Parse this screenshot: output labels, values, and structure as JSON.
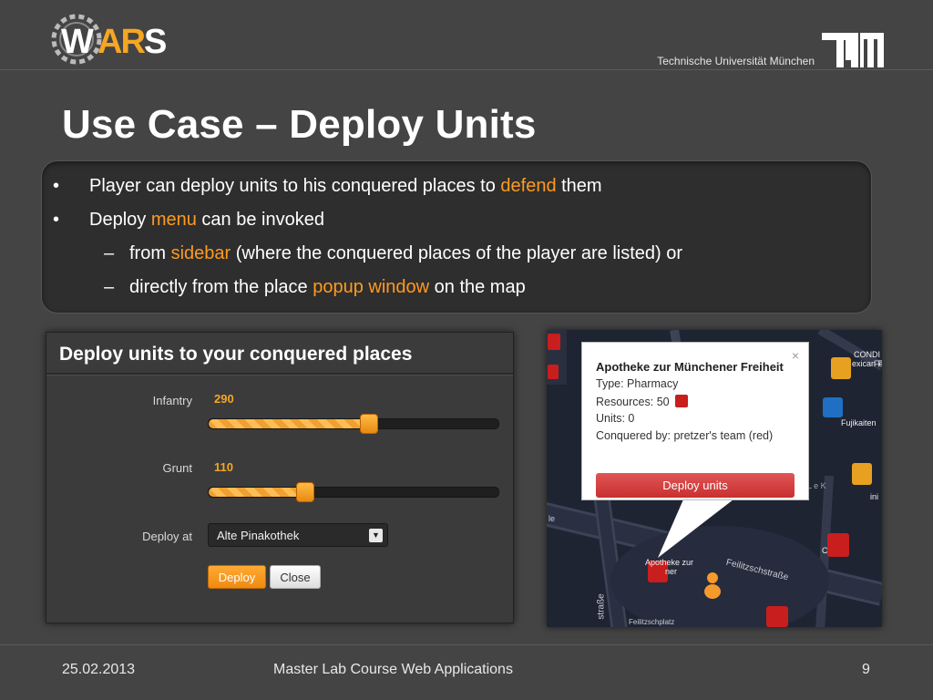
{
  "header": {
    "logo_text": "WARS",
    "university": "Technische Universität München",
    "tum_logo": "TUM"
  },
  "title": "Use Case – Deploy Units",
  "bullets": {
    "b1": {
      "marker": "•",
      "before": "Player can deploy units to his conquered places to ",
      "hl": "defend",
      "after": " them"
    },
    "b2": {
      "marker": "•",
      "before": "Deploy ",
      "hl": "menu",
      "after": " can be invoked"
    },
    "s1": {
      "marker": "–",
      "before": "from ",
      "hl": "sidebar",
      "after": " (where the conquered places of the player are listed) or"
    },
    "s2": {
      "marker": "–",
      "before": "directly from the place ",
      "hl": "popup window",
      "after": " on the map"
    },
    "highlight_color": "#ff9a1f"
  },
  "deploy_panel": {
    "title": "Deploy units to your conquered places",
    "infantry": {
      "label": "Infantry",
      "value": "290",
      "fraction": 0.55
    },
    "grunt": {
      "label": "Grunt",
      "value": "110",
      "fraction": 0.33
    },
    "deploy_at_label": "Deploy at",
    "deploy_at_value": "Alte Pinakothek",
    "deploy_button": "Deploy",
    "close_button": "Close"
  },
  "map_popup": {
    "title": "Apotheke zur Münchener Freiheit",
    "type": "Type: Pharmacy",
    "resources": "Resources: 50",
    "units": "Units: 0",
    "conquered_by": "Conquered by: pretzer's team (red)",
    "button": "Deploy units",
    "close": "×"
  },
  "map_labels": {
    "street1": "Feilitzschstraße",
    "street2": "straße",
    "street3": "Feilitzschplatz",
    "poi_fujikaiten": "Fujikaiten",
    "poi_condi": "CONDI",
    "poi_mexican": "exican F",
    "poi_apotheke": "Apotheke zur",
    "poi_apotheke2": "ner",
    "poi_lek": "L e K",
    "poi_ini": "ini",
    "poi_c": "C",
    "street_edge": "le",
    "street_fe": "Fe"
  },
  "footer": {
    "date": "25.02.2013",
    "course": "Master Lab Course Web Applications",
    "page": "9"
  },
  "colors": {
    "background": "#444444",
    "orange": "#f5a623",
    "red_button": "#d04040"
  }
}
